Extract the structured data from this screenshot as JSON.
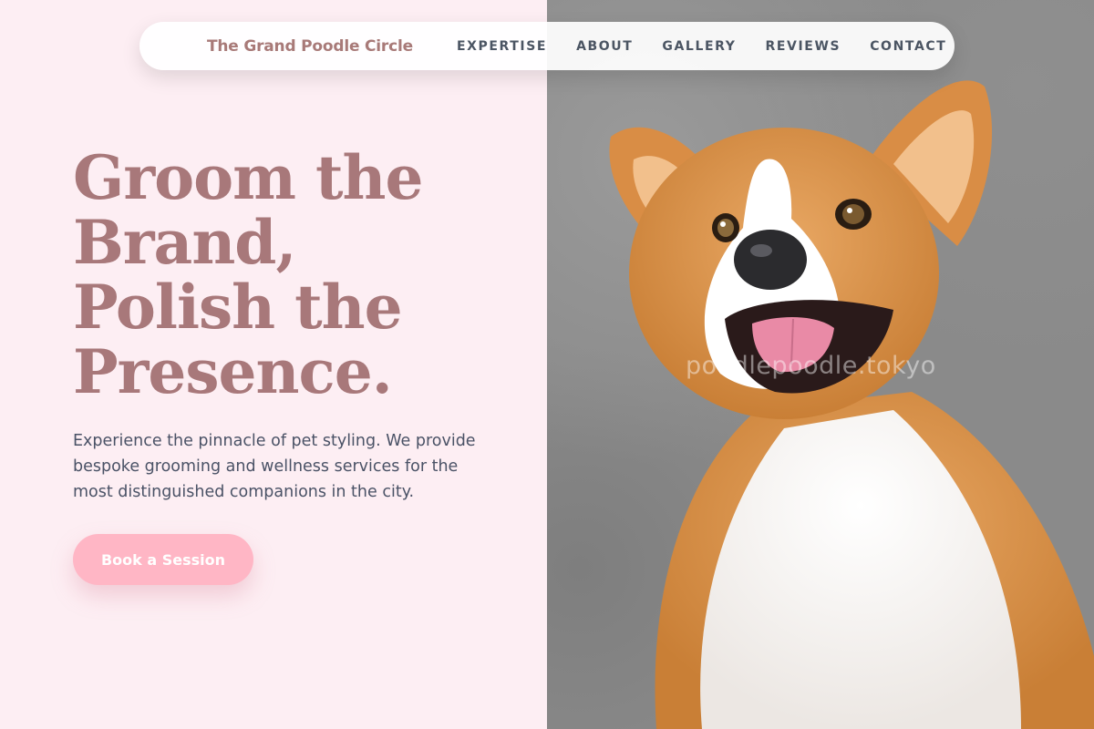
{
  "nav": {
    "brand": "The Grand Poodle Circle",
    "links": [
      "EXPERTISE",
      "ABOUT",
      "GALLERY",
      "REVIEWS",
      "CONTACT"
    ]
  },
  "hero": {
    "title_lines": [
      "Groom the",
      "Brand,",
      "Polish the",
      "Presence."
    ],
    "description": "Experience the pinnacle of pet styling. We provide bespoke grooming and wellness services for the most distinguished companions in the city.",
    "cta_label": "Book a Session"
  },
  "image": {
    "subject": "corgi-dog-photo",
    "watermark": "poodlepoodle.tokyo"
  },
  "colors": {
    "background": "#fdeef3",
    "accent": "#a8787a",
    "button": "#ffb6c5",
    "text": "#4a5266"
  }
}
